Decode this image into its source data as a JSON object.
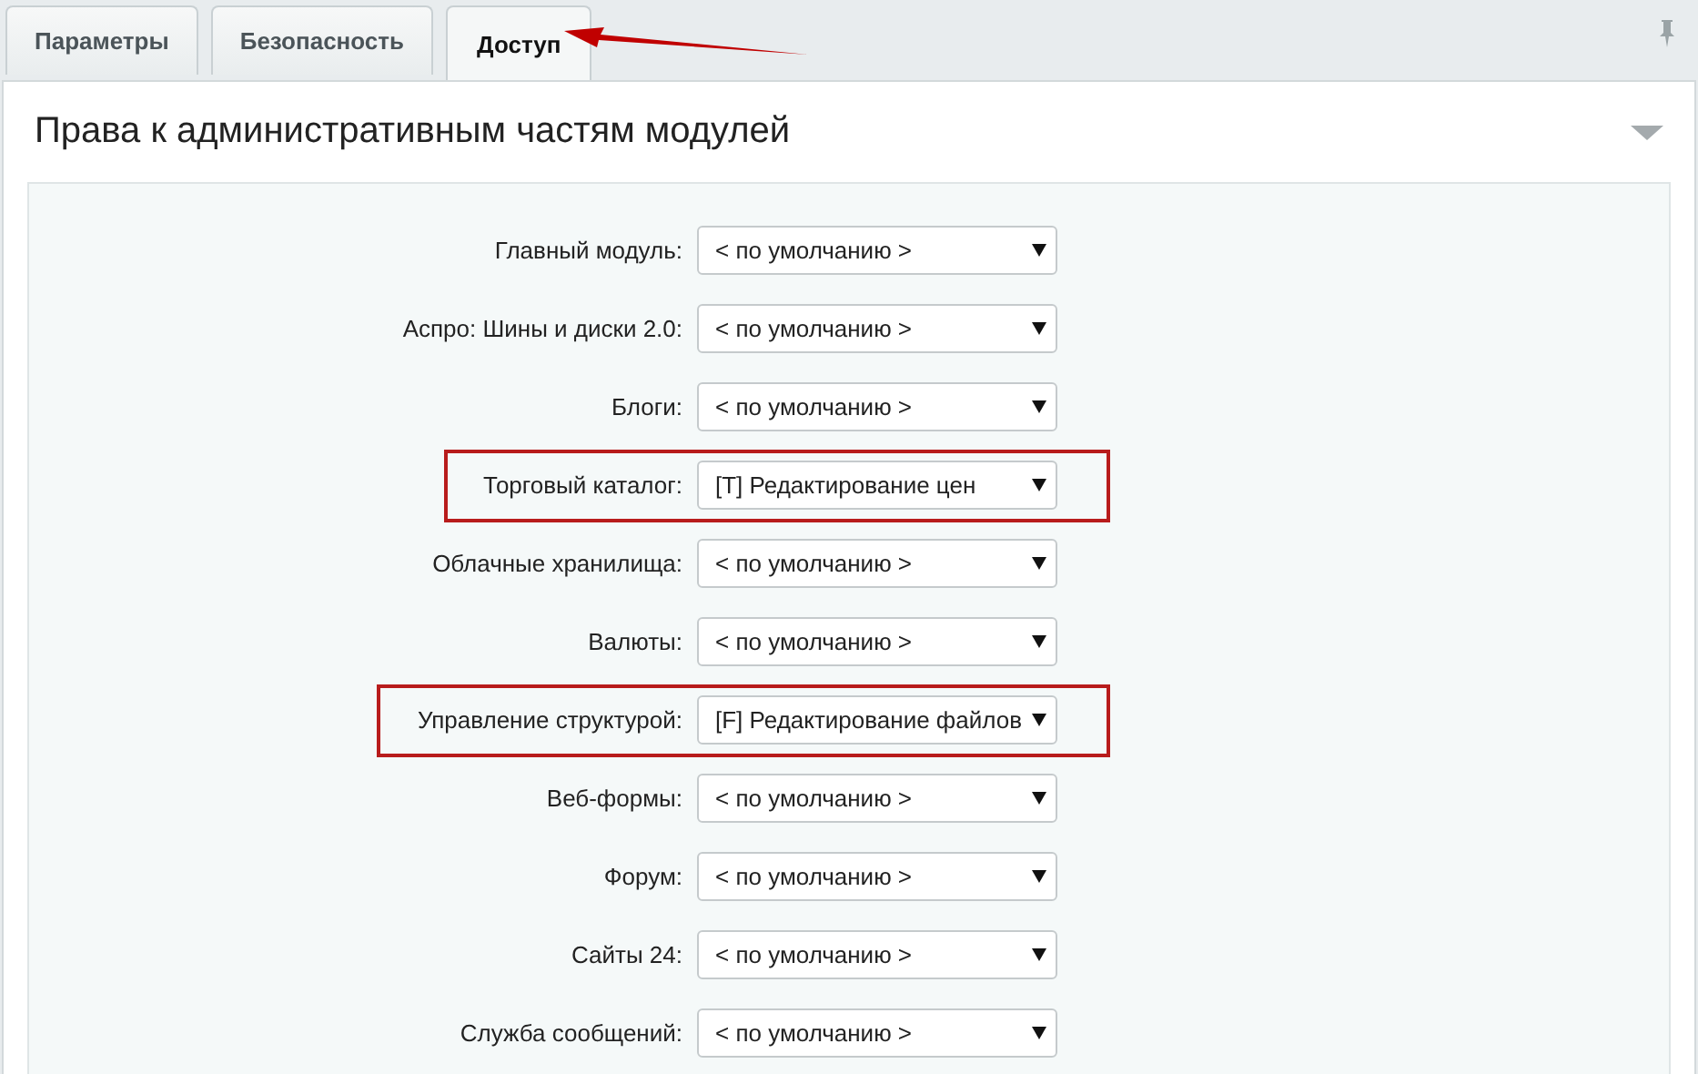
{
  "tabs": [
    {
      "label": "Параметры",
      "selected": false
    },
    {
      "label": "Безопасность",
      "selected": false
    },
    {
      "label": "Доступ",
      "selected": true
    }
  ],
  "section": {
    "title": "Права к административным частям модулей",
    "expanded": true
  },
  "rows": [
    {
      "label": "Главный модуль:",
      "value": "< по умолчанию >",
      "highlighted": false
    },
    {
      "label": "Аспро: Шины и диски 2.0:",
      "value": "< по умолчанию >",
      "highlighted": false
    },
    {
      "label": "Блоги:",
      "value": "< по умолчанию >",
      "highlighted": false
    },
    {
      "label": "Торговый каталог:",
      "value": "[T] Редактирование цен",
      "highlighted": true
    },
    {
      "label": "Облачные хранилища:",
      "value": "< по умолчанию >",
      "highlighted": false
    },
    {
      "label": "Валюты:",
      "value": "< по умолчанию >",
      "highlighted": false
    },
    {
      "label": "Управление структурой:",
      "value": "[F] Редактирование файлов",
      "highlighted": true
    },
    {
      "label": "Веб-формы:",
      "value": "< по умолчанию >",
      "highlighted": false
    },
    {
      "label": "Форум:",
      "value": "< по умолчанию >",
      "highlighted": false
    },
    {
      "label": "Сайты 24:",
      "value": "< по умолчанию >",
      "highlighted": false
    },
    {
      "label": "Служба сообщений:",
      "value": "< по умолчанию >",
      "highlighted": false
    }
  ]
}
